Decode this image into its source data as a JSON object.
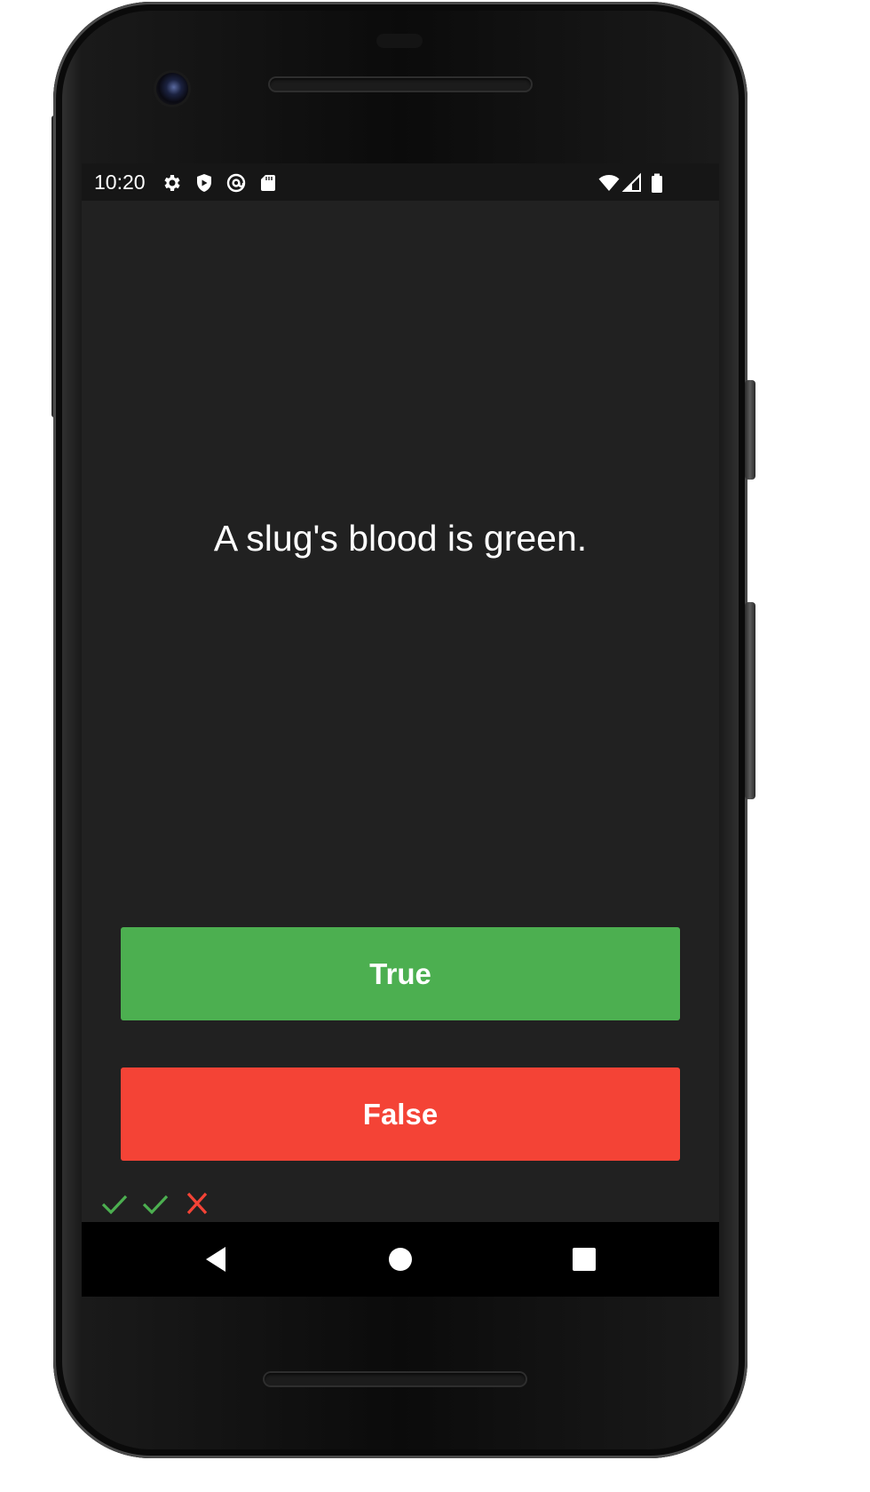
{
  "status_bar": {
    "time": "10:20",
    "left_icons": [
      "gear-icon",
      "shield-icon",
      "at-sign-icon",
      "sd-card-icon"
    ],
    "right_icons": [
      "wifi-icon",
      "cell-signal-icon",
      "battery-icon"
    ]
  },
  "quiz": {
    "question": "A slug's blood is green.",
    "true_label": "True",
    "false_label": "False",
    "score": [
      "correct",
      "correct",
      "wrong"
    ]
  },
  "colors": {
    "background": "#212121",
    "true_button": "#4caf50",
    "false_button": "#f44336",
    "correct_mark": "#4caf50",
    "wrong_mark": "#f44336"
  },
  "nav_bar": {
    "buttons": [
      "back-icon",
      "home-icon",
      "recents-icon"
    ]
  }
}
